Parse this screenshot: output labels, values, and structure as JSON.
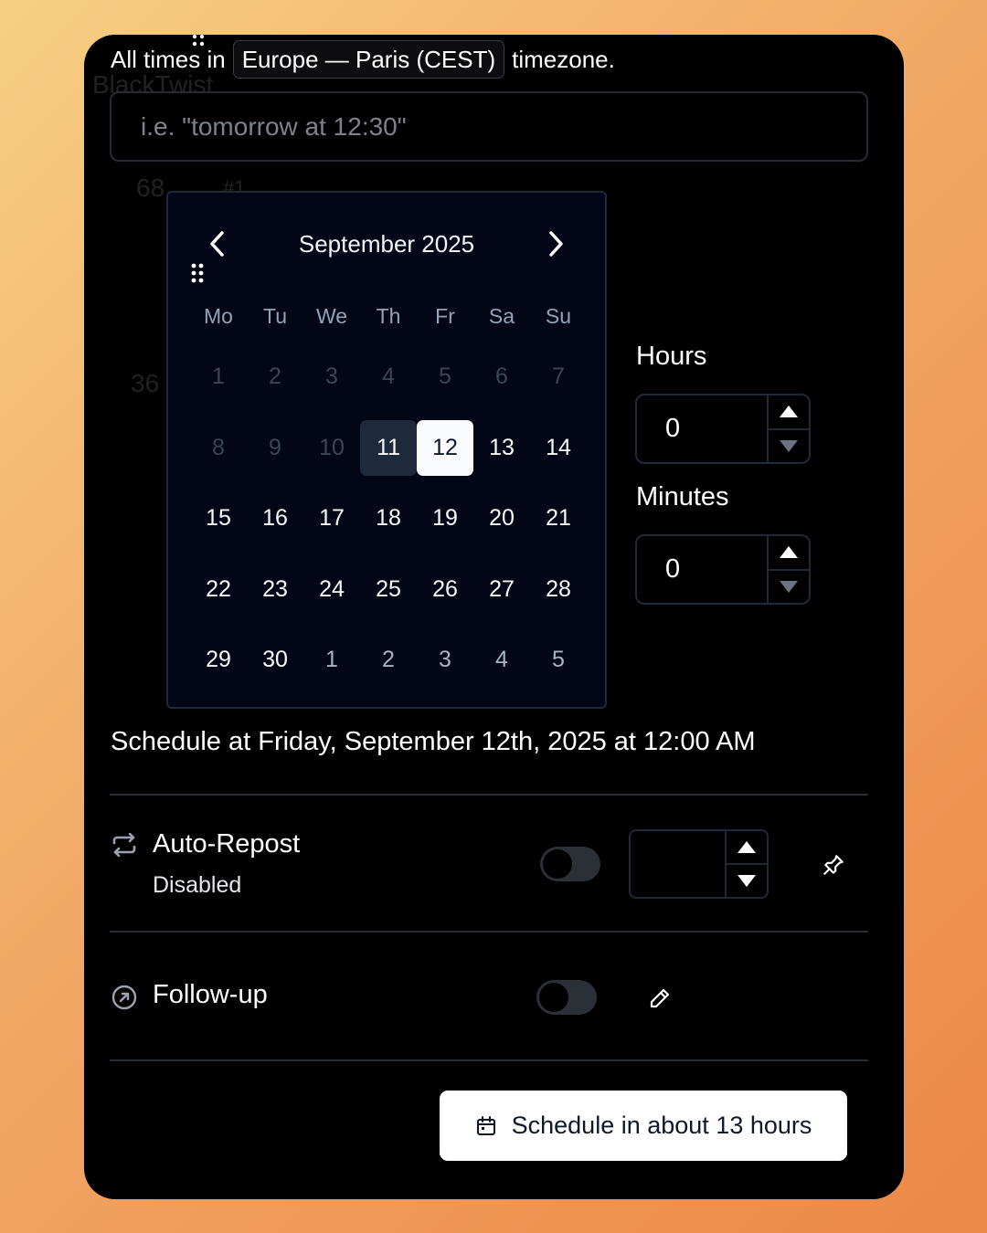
{
  "timezone": {
    "prefix": "All times in",
    "value": "Europe — Paris (CEST)",
    "suffix": "timezone."
  },
  "background_text": {
    "brand": "BlackTwist",
    "count_a": "68",
    "tag": "#1",
    "count_b": "36"
  },
  "natural_input": {
    "placeholder": "i.e. \"tomorrow at 12:30\""
  },
  "calendar": {
    "month_label": "September 2025",
    "weekdays": [
      "Mo",
      "Tu",
      "We",
      "Th",
      "Fr",
      "Sa",
      "Su"
    ],
    "days": [
      {
        "label": "1",
        "state": "muted"
      },
      {
        "label": "2",
        "state": "muted"
      },
      {
        "label": "3",
        "state": "muted"
      },
      {
        "label": "4",
        "state": "muted"
      },
      {
        "label": "5",
        "state": "muted"
      },
      {
        "label": "6",
        "state": "muted"
      },
      {
        "label": "7",
        "state": "muted"
      },
      {
        "label": "8",
        "state": "muted"
      },
      {
        "label": "9",
        "state": "muted"
      },
      {
        "label": "10",
        "state": "muted"
      },
      {
        "label": "11",
        "state": "today"
      },
      {
        "label": "12",
        "state": "selected"
      },
      {
        "label": "13",
        "state": "normal"
      },
      {
        "label": "14",
        "state": "normal"
      },
      {
        "label": "15",
        "state": "normal"
      },
      {
        "label": "16",
        "state": "normal"
      },
      {
        "label": "17",
        "state": "normal"
      },
      {
        "label": "18",
        "state": "normal"
      },
      {
        "label": "19",
        "state": "normal"
      },
      {
        "label": "20",
        "state": "normal"
      },
      {
        "label": "21",
        "state": "normal"
      },
      {
        "label": "22",
        "state": "normal"
      },
      {
        "label": "23",
        "state": "normal"
      },
      {
        "label": "24",
        "state": "normal"
      },
      {
        "label": "25",
        "state": "normal"
      },
      {
        "label": "26",
        "state": "normal"
      },
      {
        "label": "27",
        "state": "normal"
      },
      {
        "label": "28",
        "state": "normal"
      },
      {
        "label": "29",
        "state": "normal"
      },
      {
        "label": "30",
        "state": "normal"
      },
      {
        "label": "1",
        "state": "outside"
      },
      {
        "label": "2",
        "state": "outside"
      },
      {
        "label": "3",
        "state": "outside"
      },
      {
        "label": "4",
        "state": "outside"
      },
      {
        "label": "5",
        "state": "outside"
      }
    ]
  },
  "time": {
    "hours_label": "Hours",
    "hours_value": "0",
    "minutes_label": "Minutes",
    "minutes_value": "0"
  },
  "summary": "Schedule at Friday, September 12th, 2025 at 12:00 AM",
  "auto_repost": {
    "title": "Auto-Repost",
    "status": "Disabled",
    "enabled": false,
    "icon": "repeat-icon"
  },
  "follow_up": {
    "title": "Follow-up",
    "enabled": false,
    "icon": "arrow-up-right-circle-icon"
  },
  "schedule_button": {
    "label": "Schedule in about 13 hours",
    "icon": "calendar-icon"
  },
  "colors": {
    "panel": "#000000",
    "calendar_bg": "#020617",
    "selected_day": "#f8fafc",
    "today_day": "#1e293b"
  }
}
